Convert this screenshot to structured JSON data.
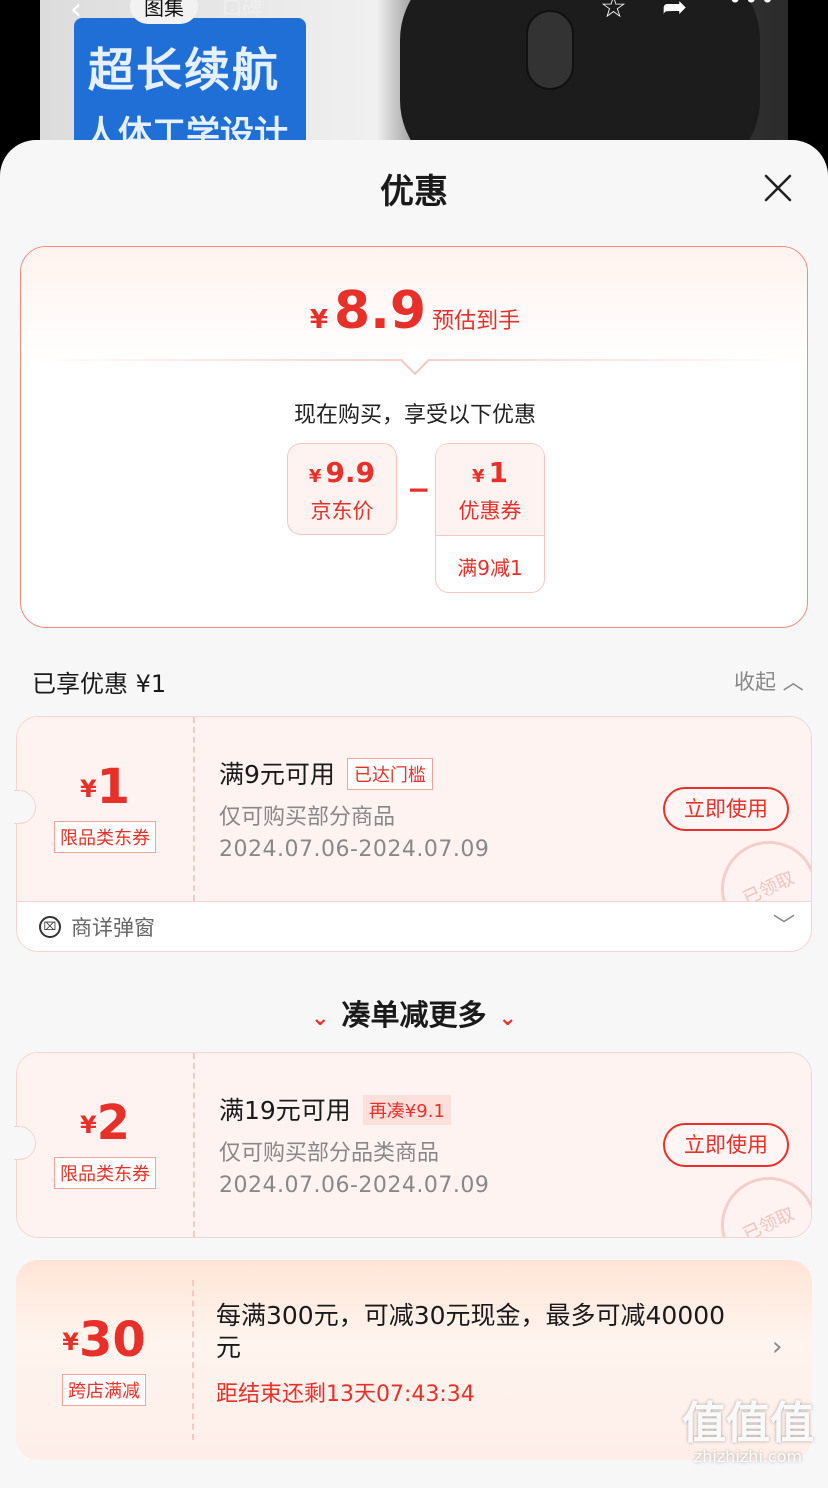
{
  "background": {
    "nav": {
      "back_icon": "chevron-left-icon",
      "tab_gallery": "图集",
      "tab_reviews": "口碑",
      "star_icon": "star-icon",
      "share_icon": "share-icon",
      "more_icon": "more-dots-icon"
    },
    "banner_line1": "超长续航",
    "banner_line2": "人体工学设计"
  },
  "sheet": {
    "title": "优惠",
    "close_icon": "close-icon"
  },
  "summary": {
    "currency": "¥",
    "estimated_price": "8.9",
    "estimated_label": "预估到手",
    "buy_note": "现在购买，享受以下优惠",
    "jd_price_currency": "¥",
    "jd_price": "9.9",
    "jd_price_label": "京东价",
    "minus": "−",
    "coupon_currency": "¥",
    "coupon_value": "1",
    "coupon_label": "优惠券",
    "coupon_condition": "满9减1"
  },
  "enjoyed": {
    "label": "已享优惠 ¥1",
    "collapse": "收起"
  },
  "coupons": [
    {
      "currency": "¥",
      "value": "1",
      "tag": "限品类东券",
      "title": "满9元可用",
      "badge": "已达门槛",
      "desc": "仅可购买部分商品",
      "date": "2024.07.06-2024.07.09",
      "button": "立即使用",
      "stamp": "已领取",
      "footer": "商详弹窗"
    },
    {
      "currency": "¥",
      "value": "2",
      "tag": "限品类东券",
      "title": "满19元可用",
      "badge": "再凑¥9.1",
      "desc": "仅可购买部分品类商品",
      "date": "2024.07.06-2024.07.09",
      "button": "立即使用",
      "stamp": "已领取"
    }
  ],
  "more_section_title": "凑单减更多",
  "promo": {
    "currency": "¥",
    "value": "30",
    "tag": "跨店满减",
    "text": "每满300元，可减30元现金，最多可减40000元",
    "countdown": "距结束还剩13天07:43:34"
  },
  "watermark": {
    "text": "值值值",
    "domain": "zhizhizhi.com"
  },
  "colors": {
    "accent": "#e8302a",
    "coupon_bg": "#fff3f1"
  }
}
